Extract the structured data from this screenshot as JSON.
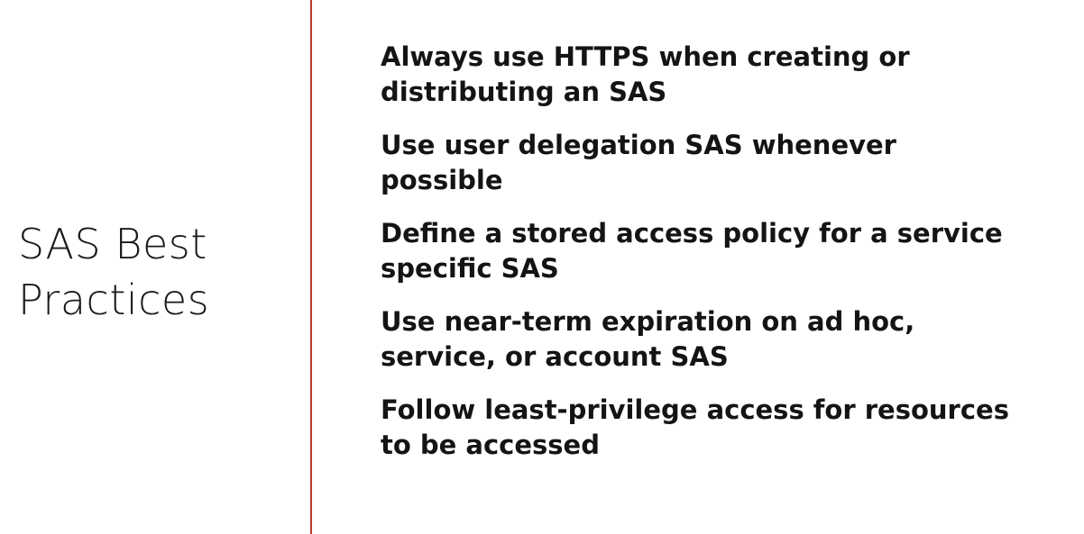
{
  "slide": {
    "title_lines": [
      "SAS Best",
      "Practices"
    ],
    "accent_color": "#c0392b",
    "points": [
      {
        "lines": [
          "Always use HTTPS when creating or",
          "distributing an SAS"
        ]
      },
      {
        "lines": [
          "Use user delegation SAS whenever",
          "possible"
        ]
      },
      {
        "lines": [
          "Define a stored access policy for a service",
          "specific SAS"
        ]
      },
      {
        "lines": [
          "Use near-term expiration on ad hoc,",
          "service, or account SAS"
        ]
      },
      {
        "lines": [
          "Follow least-privilege access for resources",
          "to be accessed"
        ]
      }
    ]
  }
}
